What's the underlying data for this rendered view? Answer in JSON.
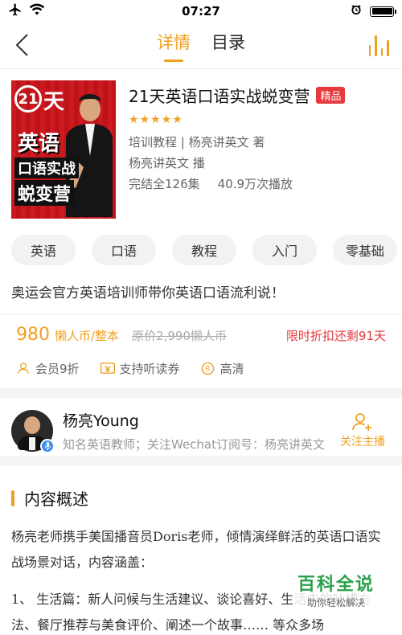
{
  "status": {
    "time": "07:27"
  },
  "nav": {
    "tabs": [
      "详情",
      "目录"
    ]
  },
  "course": {
    "cover_text": {
      "num": "21",
      "tian": "天",
      "line1": "英语",
      "line2": "口语实战",
      "line3": "蜕变营"
    },
    "title": "21天英语口语实战蜕变营",
    "badge": "精品",
    "rating_stars": 5,
    "meta1": "培训教程 | 杨亮讲英文 著",
    "meta2": "杨亮讲英文 播",
    "episodes": "完结全126集",
    "plays": "40.9万次播放"
  },
  "tags": [
    "英语",
    "口语",
    "教程",
    "入门",
    "零基础"
  ],
  "description": "奥运会官方英语培训师带你英语口语流利说！",
  "price": {
    "amount": "980",
    "unit": "懒人币/整本",
    "original": "原价2,990懒人币",
    "countdown": "限时折扣还剩91天"
  },
  "perks": {
    "member": "会员9折",
    "voucher": "支持听读券",
    "hd": "高清"
  },
  "anchor": {
    "name": "杨亮Young",
    "bio": "知名英语教师；关注Wechat订阅号：杨亮讲英文",
    "follow_label": "关注主播"
  },
  "content": {
    "heading": "内容概述",
    "para1": "杨亮老师携手美国播音员Doris老师，倾情演绎鲜活的英语口语实战场景对话，内容涵盖：",
    "para2": "1、 生活篇：新人问候与生活建议、谈论喜好、生活中的吐槽方法、餐厅推荐与美食评价、阐述一个故事…… 等众多场"
  },
  "watermark": {
    "main": "百科全说",
    "sub": "助你轻松解决"
  },
  "colors": {
    "accent": "#f0a020",
    "red": "#e6393c",
    "badge_blue": "#3b8ef0"
  },
  "icons": [
    "airplane-icon",
    "wifi-icon",
    "alarm-icon",
    "battery-icon",
    "back-icon",
    "audio-playing-icon",
    "star-icon",
    "user-icon",
    "voucher-icon",
    "hd-icon",
    "mic-icon",
    "add-user-icon"
  ]
}
